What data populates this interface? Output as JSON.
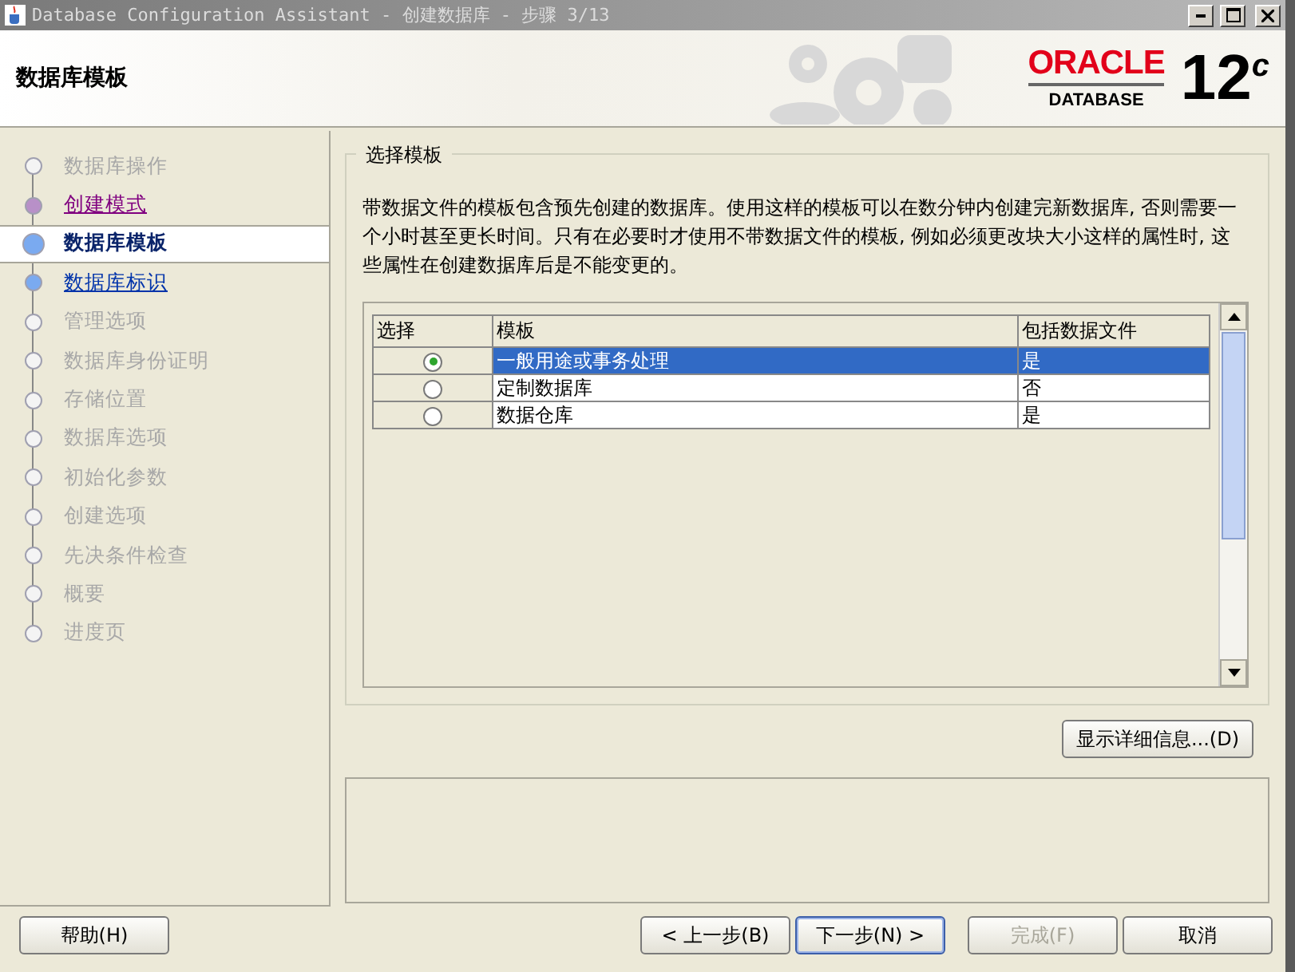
{
  "window": {
    "title": "Database Configuration Assistant - 创建数据库 - 步骤 3/13"
  },
  "header": {
    "title": "数据库模板",
    "logo": {
      "brand": "ORACLE",
      "product": "DATABASE",
      "version": "12$^{c}$"
    }
  },
  "steps": [
    {
      "label": "数据库操作",
      "kind": "pending",
      "selected": false
    },
    {
      "label": "创建模式",
      "kind": "visited",
      "selected": false
    },
    {
      "label": "数据库模板",
      "kind": "current",
      "selected": true
    },
    {
      "label": "数据库标识",
      "kind": "available",
      "selected": false
    },
    {
      "label": "管理选项",
      "kind": "pending",
      "selected": false
    },
    {
      "label": "数据库身份证明",
      "kind": "pending",
      "selected": false
    },
    {
      "label": "存储位置",
      "kind": "pending",
      "selected": false
    },
    {
      "label": "数据库选项",
      "kind": "pending",
      "selected": false
    },
    {
      "label": "初始化参数",
      "kind": "pending",
      "selected": false
    },
    {
      "label": "创建选项",
      "kind": "pending",
      "selected": false
    },
    {
      "label": "先决条件检查",
      "kind": "pending",
      "selected": false
    },
    {
      "label": "概要",
      "kind": "pending",
      "selected": false
    },
    {
      "label": "进度页",
      "kind": "pending",
      "selected": false
    }
  ],
  "section": {
    "title": "选择模板",
    "description": "带数据文件的模板包含预先创建的数据库。使用这样的模板可以在数分钟内创建完新数据库, 否则需要一个小时甚至更长时间。只有在必要时才使用不带数据文件的模板, 例如必须更改块大小这样的属性时, 这些属性在创建数据库后是不能变更的。"
  },
  "table": {
    "columns": [
      "选择",
      "模板",
      "包括数据文件"
    ],
    "rows": [
      {
        "template": "一般用途或事务处理",
        "includes_datafiles": "是",
        "selected": true
      },
      {
        "template": "定制数据库",
        "includes_datafiles": "否",
        "selected": false
      },
      {
        "template": "数据仓库",
        "includes_datafiles": "是",
        "selected": false
      }
    ]
  },
  "details_button": "显示详细信息...(D)",
  "buttons": [
    {
      "label": "帮助(H)",
      "disabled": false,
      "default": false
    },
    {
      "label": "< 上一步(B)",
      "disabled": false,
      "default": false
    },
    {
      "label": "下一步(N) >",
      "disabled": false,
      "default": true
    },
    {
      "label": "完成(F)",
      "disabled": true,
      "default": false
    },
    {
      "label": "取消",
      "disabled": false,
      "default": false
    }
  ]
}
